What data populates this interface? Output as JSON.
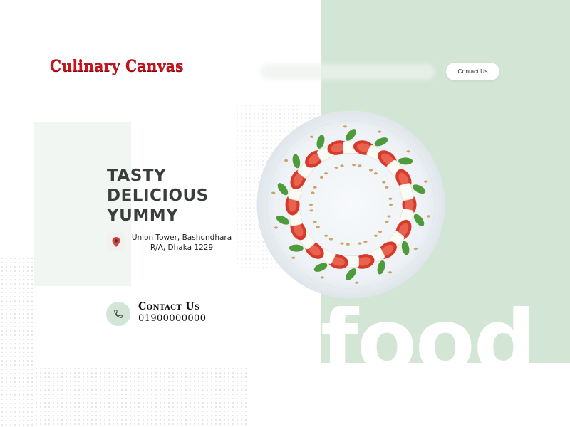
{
  "brand": {
    "name": "Culinary Canvas",
    "color": "#c8141c"
  },
  "nav": {
    "contact_button": "Contact Us"
  },
  "hero": {
    "headline_lines": [
      "TASTY",
      "DELICIOUS",
      "YUMMY"
    ],
    "address_lines": [
      "Union Tower, Bashundhara",
      "R/A, Dhaka 1229"
    ],
    "contact_title": "Contact Us",
    "contact_number": "01900000000",
    "background_word": "food",
    "dish_image": "caprese-salad-plate"
  },
  "icons": {
    "location": "location-pin-icon",
    "phone": "phone-icon"
  },
  "colors": {
    "accent_green": "#d3e6d6",
    "headline": "#3a3d3c"
  }
}
